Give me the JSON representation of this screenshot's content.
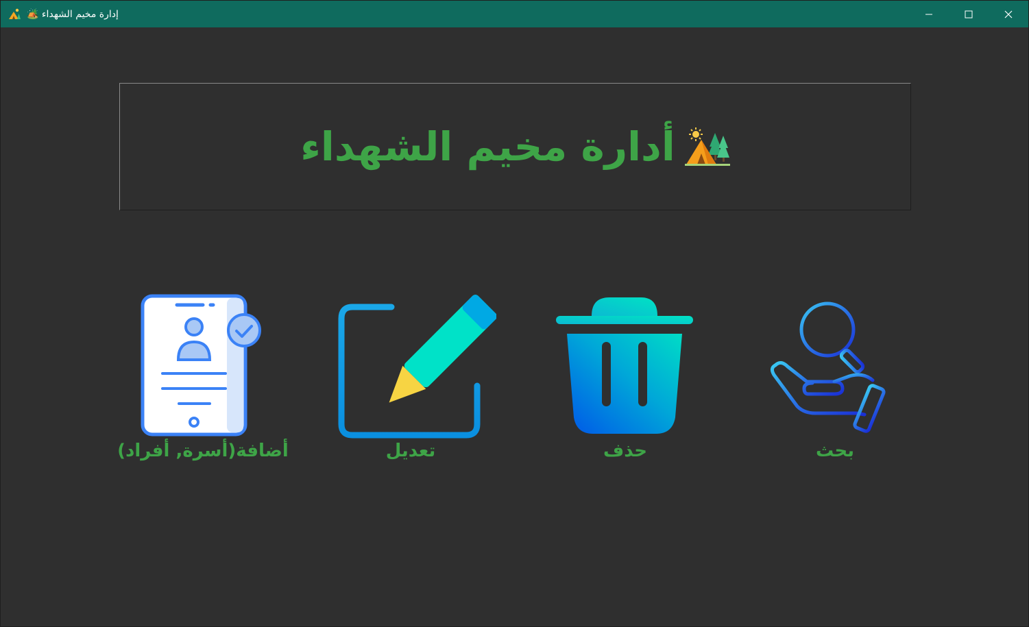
{
  "window": {
    "title": "إدارة مخيم الشهداء 🏕️",
    "controls": [
      "minimize",
      "maximize",
      "close"
    ]
  },
  "header": {
    "title": "أدارة مخيم الشهداء",
    "emoji_icon": "camping-tent-icon"
  },
  "actions": [
    {
      "id": "add",
      "label": "أضافة(أسرة, أفراد)",
      "icon": "user-profile-document-icon"
    },
    {
      "id": "edit",
      "label": "تعديل",
      "icon": "edit-pencil-icon"
    },
    {
      "id": "delete",
      "label": "حذف",
      "icon": "trash-icon"
    },
    {
      "id": "search",
      "label": "بحث",
      "icon": "search-hand-icon"
    }
  ],
  "colors": {
    "titlebar": "#0f6b5e",
    "background": "#2f2f2f",
    "accent_green": "#3ea447"
  }
}
